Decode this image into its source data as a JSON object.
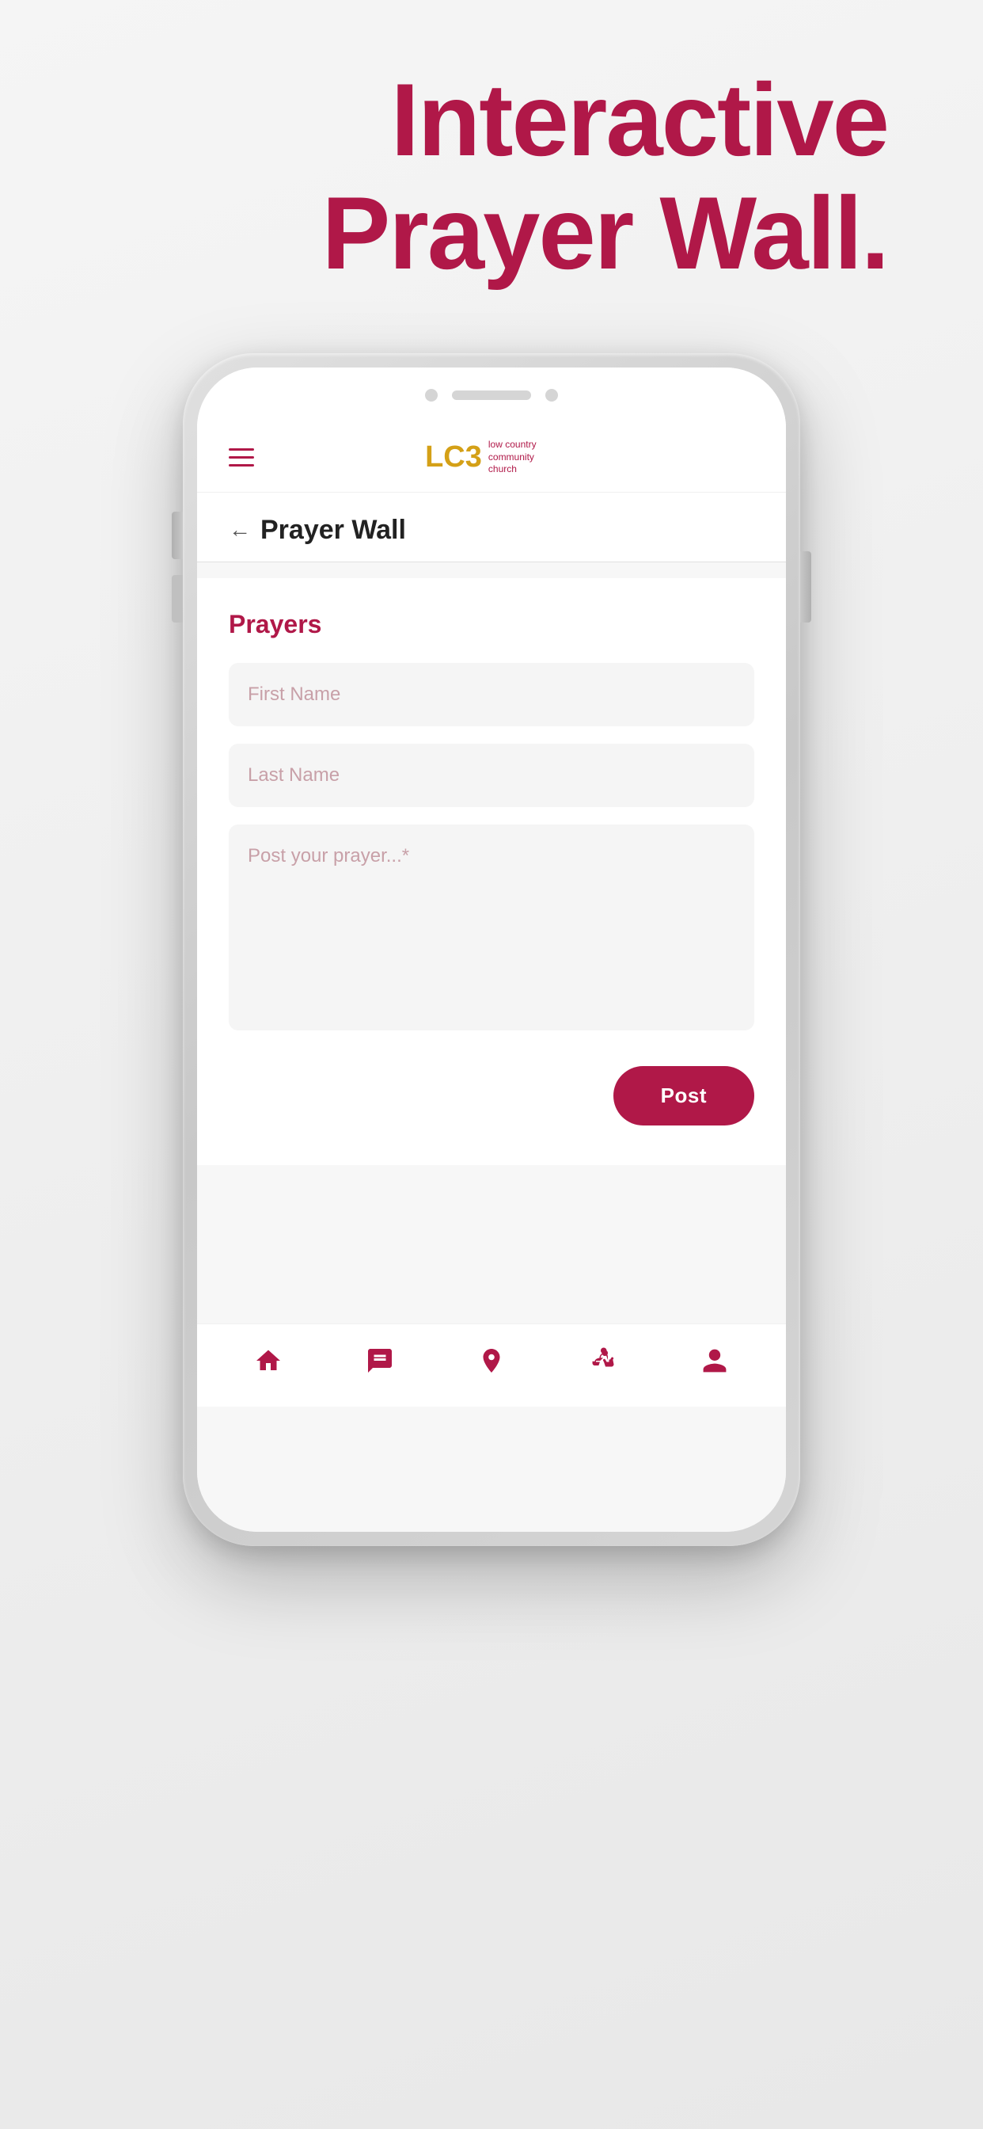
{
  "page": {
    "title_line1": "Interactive",
    "title_line2": "Prayer Wall.",
    "title_color": "#b01848"
  },
  "header": {
    "hamburger_label": "menu",
    "logo_lc": "LC",
    "logo_3": "3",
    "logo_subtitle": "low country community church"
  },
  "nav": {
    "back_arrow": "←",
    "page_title": "Prayer Wall"
  },
  "form": {
    "section_heading": "Prayers",
    "first_name_placeholder": "First Name",
    "last_name_placeholder": "Last Name",
    "prayer_placeholder": "Post your prayer...*",
    "post_button_label": "Post"
  },
  "bottom_nav": {
    "items": [
      {
        "id": "home",
        "label": "Home"
      },
      {
        "id": "chat",
        "label": "Chat"
      },
      {
        "id": "location",
        "label": "Location"
      },
      {
        "id": "give",
        "label": "Give"
      },
      {
        "id": "profile",
        "label": "Profile"
      }
    ]
  }
}
